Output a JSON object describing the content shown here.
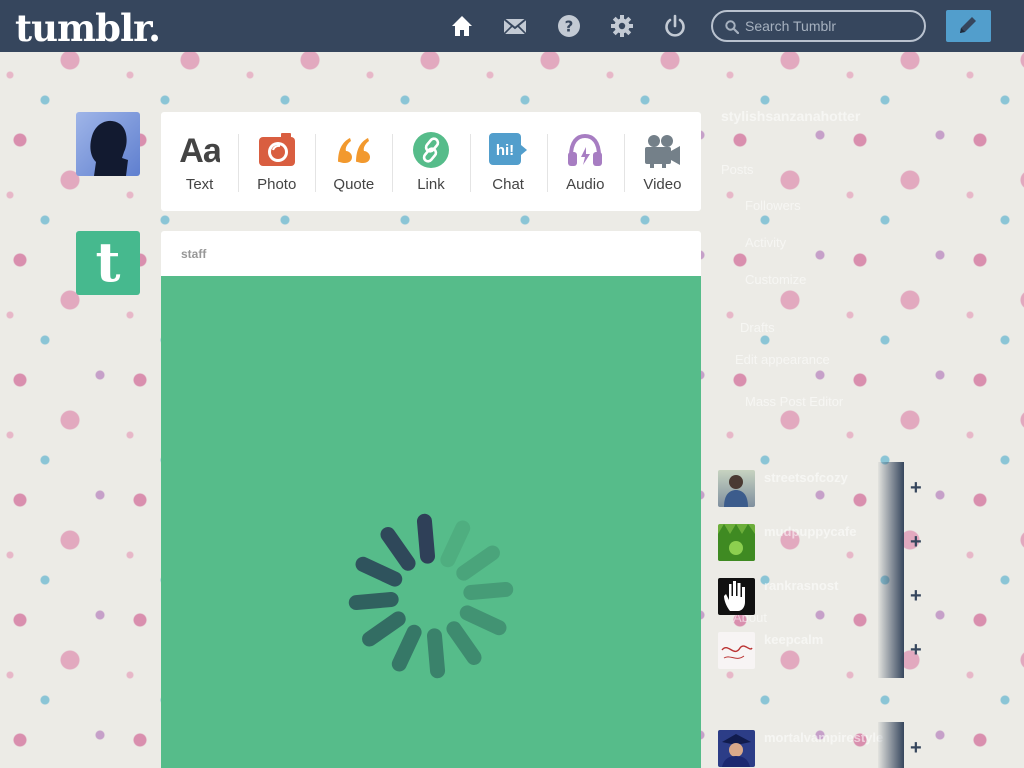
{
  "header": {
    "logo": "tumblr.",
    "nav": [
      {
        "name": "home-icon"
      },
      {
        "name": "inbox-icon"
      },
      {
        "name": "help-icon"
      },
      {
        "name": "settings-icon"
      },
      {
        "name": "logout-icon"
      }
    ],
    "search_placeholder": "Search Tumblr",
    "compose_icon": "pencil-icon"
  },
  "colors": {
    "header_bg": "#36465d",
    "accent": "#529ecc",
    "staff_green": "#56bc8a"
  },
  "post_types": [
    {
      "label": "Text",
      "icon": "text-icon",
      "color": "#444444"
    },
    {
      "label": "Photo",
      "icon": "camera-icon",
      "color": "#d95e40"
    },
    {
      "label": "Quote",
      "icon": "quote-icon",
      "color": "#f2992e"
    },
    {
      "label": "Link",
      "icon": "link-icon",
      "color": "#56bc8a"
    },
    {
      "label": "Chat",
      "icon": "chat-icon",
      "color": "#529ecc"
    },
    {
      "label": "Audio",
      "icon": "headphones-icon",
      "color": "#a77dc2"
    },
    {
      "label": "Video",
      "icon": "video-camera-icon",
      "color": "#748089"
    }
  ],
  "post": {
    "author": "staff",
    "media_state": "loading"
  },
  "sidebar": {
    "blog_name": "stylishsanzanahotter",
    "links": [
      "Posts",
      "Followers",
      "Activity",
      "Customize",
      "Drafts",
      "Edit appearance",
      "Mass Post Editor"
    ],
    "about": "About"
  },
  "recommended": [
    {
      "name": "streetsofcozy",
      "thumb": "person-photo"
    },
    {
      "name": "mudpuppycafe",
      "thumb": "green-creature-photo"
    },
    {
      "name": "rankrasnost",
      "thumb": "hand-icon"
    },
    {
      "name": "keepcalm",
      "thumb": "sketch-photo"
    },
    {
      "name": "mortalvampirestyle",
      "thumb": "person-hat-photo"
    }
  ]
}
